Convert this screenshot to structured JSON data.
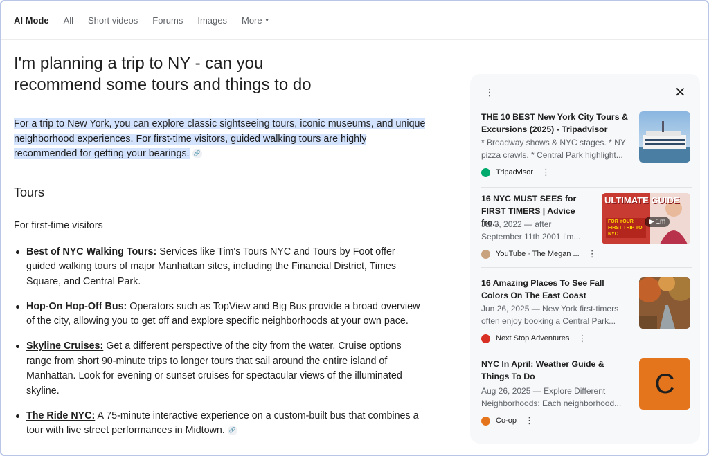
{
  "nav": {
    "tabs": [
      "AI Mode",
      "All",
      "Short videos",
      "Forums",
      "Images",
      "More"
    ],
    "caret": "▾"
  },
  "main": {
    "query": "I'm planning a trip to NY - can you recommend some tours and things to do",
    "intro": "For a trip to New York, you can explore classic sightseeing tours, iconic museums, and unique neighborhood experiences. For first-time visitors, guided walking tours are highly recommended for getting your bearings.",
    "heading": "Tours",
    "subheading": "For first-time visitors",
    "items": [
      {
        "term": "Best of NYC Walking Tours:",
        "text": " Services like Tim's Tours NYC and Tours by Foot offer guided walking tours of major Manhattan sites, including the Financial District, Times Square, and Central Park."
      },
      {
        "term": "Hop-On Hop-Off Bus:",
        "text_before": " Operators such as ",
        "link": "TopView",
        "text_after": " and Big Bus provide a broad overview of the city, allowing you to get off and explore specific neighborhoods at your own pace."
      },
      {
        "term": "Skyline Cruises:",
        "text": " Get a different perspective of the city from the water. Cruise options range from short 90-minute trips to longer tours that sail around the entire island of Manhattan. Look for evening or sunset cruises for spectacular views of the illuminated skyline."
      },
      {
        "term": "The Ride NYC:",
        "text": " A 75-minute interactive experience on a custom-built bus that combines a tour with live street performances in Midtown."
      }
    ]
  },
  "panel": {
    "kebab": "⋮",
    "close": "✕",
    "cards": [
      {
        "title": "THE 10 BEST New York City Tours & Excursions (2025) - Tripadvisor",
        "snippet1": "* Broadway shows & NYC stages. * NY",
        "snippet2": "pizza crawls. * Central Park highlight...",
        "source": "Tripadvisor",
        "source_color": "#34e0a1"
      },
      {
        "title": "16 NYC MUST SEES for FIRST TIMERS | Advice fro...",
        "snippet1": "Jul 3, 2022 — after",
        "snippet2": "September 11th 2001 I'm...",
        "source": "YouTube · The Megan ...",
        "source_color": "#c9a27e",
        "thumb_title": "ULTIMATE GUIDE",
        "thumb_sub": "FOR YOUR FIRST TRIP TO NYC",
        "duration": "▶ 1m"
      },
      {
        "title": "16 Amazing Places To See Fall Colors On The East Coast",
        "snippet1": "Jun 26, 2025 — New York first-timers",
        "snippet2": "often enjoy booking a Central Park...",
        "source": "Next Stop Adventures",
        "source_color": "#d93025"
      },
      {
        "title": "NYC In April: Weather Guide & Things To Do",
        "snippet1": "Aug 26, 2025 — Explore Different",
        "snippet2": "Neighborhoods: Each neighborhood...",
        "source": "Co-op",
        "source_color": "#e4751d",
        "logo_letter": "C"
      }
    ]
  }
}
